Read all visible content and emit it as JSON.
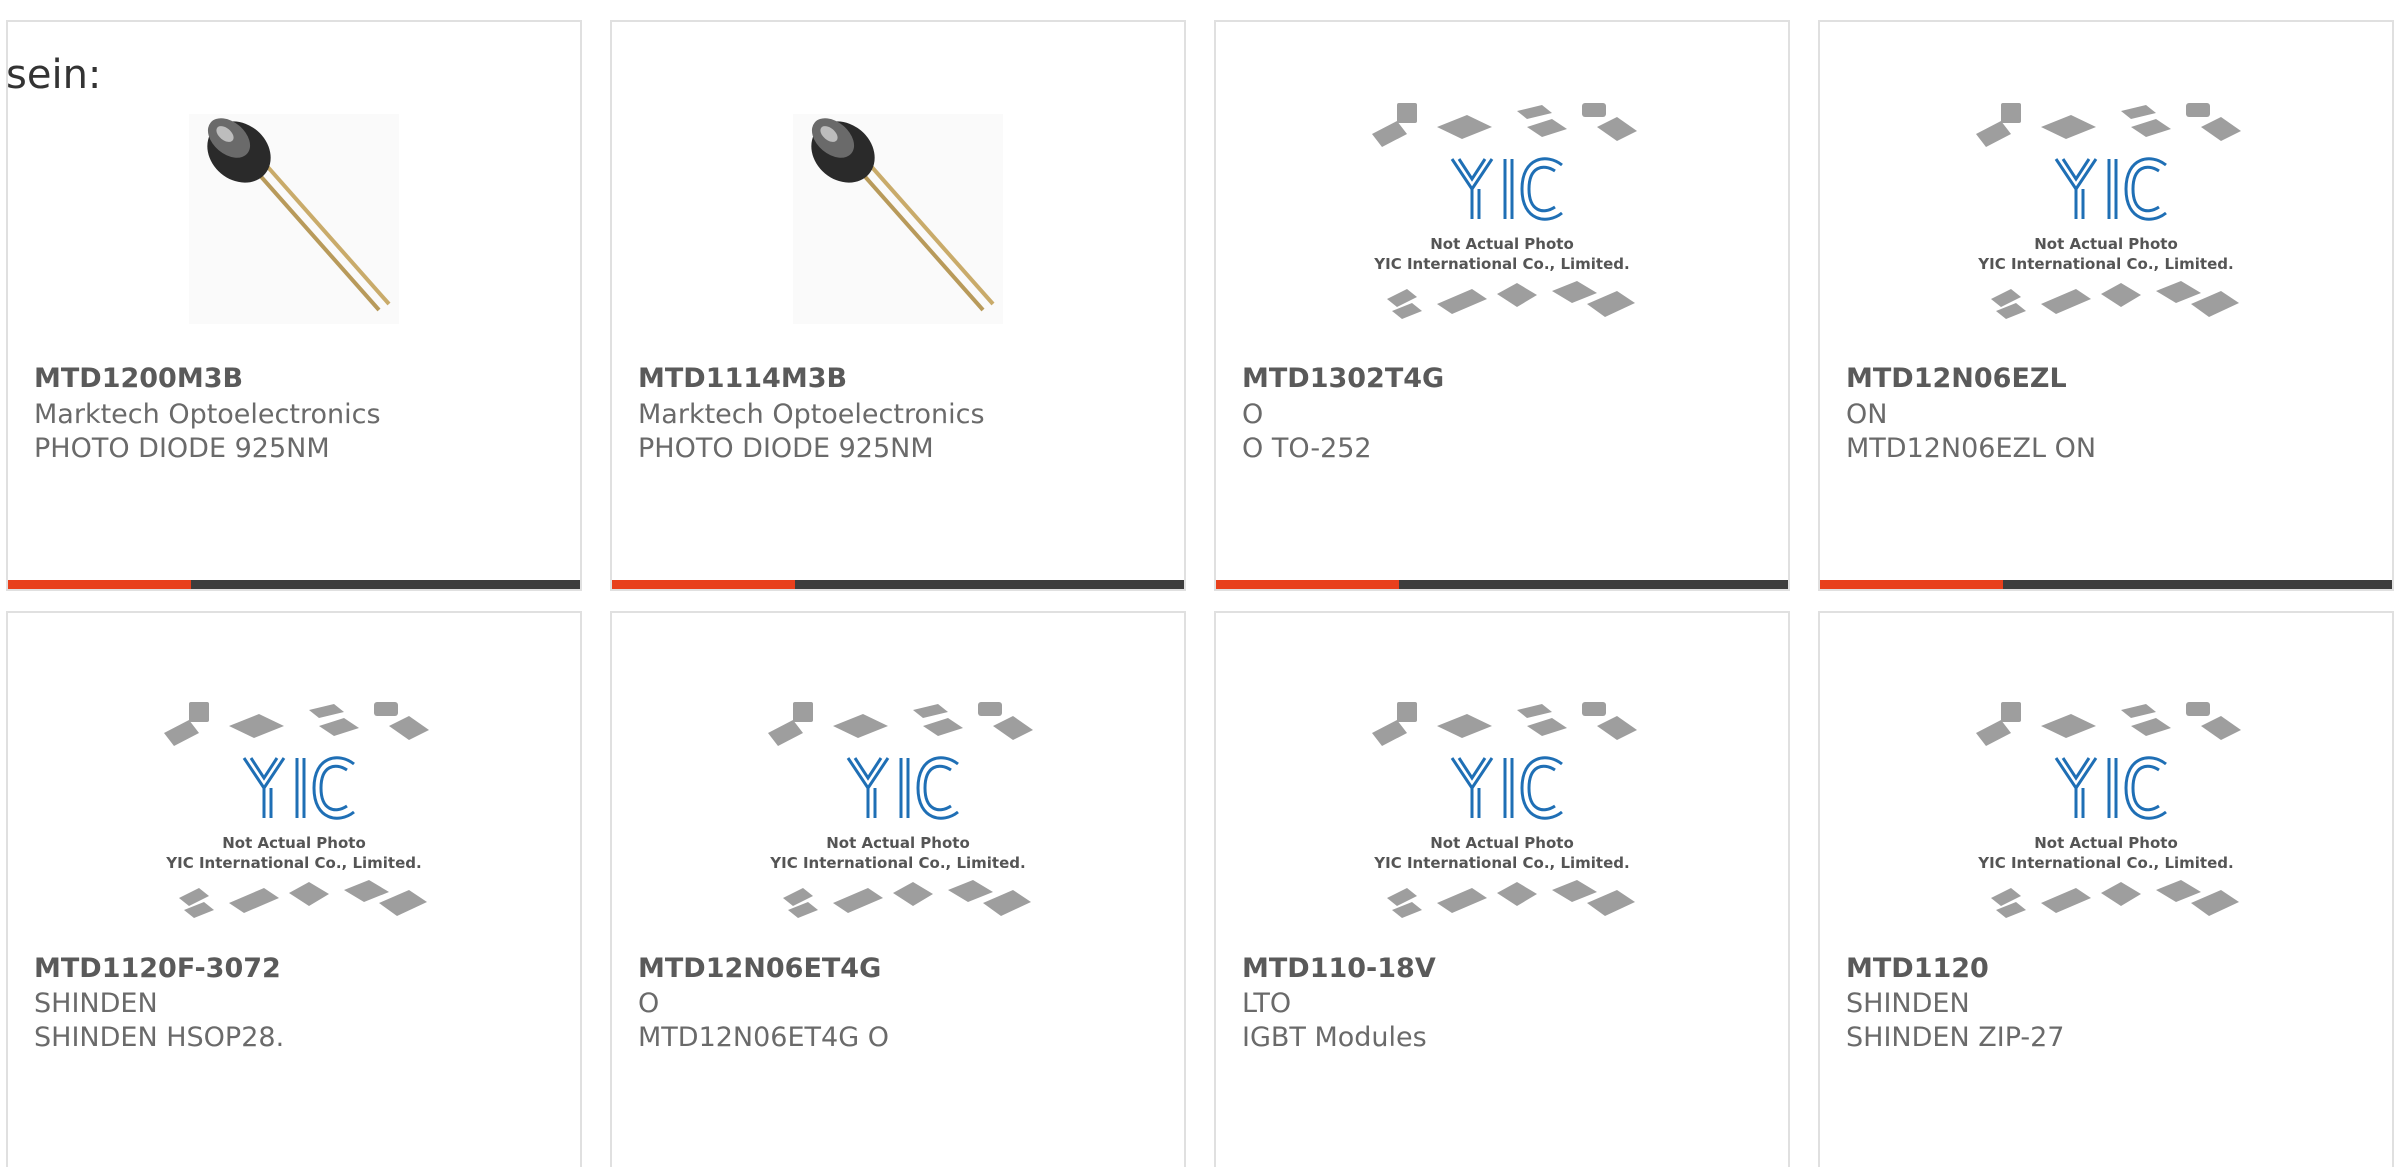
{
  "heading_fragment": "sein:",
  "colors": {
    "accent": "#e8401c",
    "bar_track": "#3d3d3d",
    "card_border": "#e0e0e0",
    "text": "#6a6a6a"
  },
  "products": [
    {
      "part": "MTD1200M3B",
      "maker": "Marktech Optoelectronics",
      "desc": "PHOTO DIODE 925NM",
      "image": "photodiode-photo",
      "progress": 0.32
    },
    {
      "part": "MTD1114M3B",
      "maker": "Marktech Optoelectronics",
      "desc": "PHOTO DIODE 925NM",
      "image": "photodiode-photo",
      "progress": 0.32
    },
    {
      "part": "MTD1302T4G",
      "maker": "O",
      "desc": "O TO-252",
      "image": "placeholder-logo",
      "progress": 0.32
    },
    {
      "part": "MTD12N06EZL",
      "maker": "ON",
      "desc": "MTD12N06EZL ON",
      "image": "placeholder-logo",
      "progress": 0.32
    },
    {
      "part": "MTD1120F-3072",
      "maker": "SHINDEN",
      "desc": "SHINDEN HSOP28.",
      "image": "placeholder-logo"
    },
    {
      "part": "MTD12N06ET4G",
      "maker": "O",
      "desc": "MTD12N06ET4G O",
      "image": "placeholder-logo"
    },
    {
      "part": "MTD110-18V",
      "maker": "LTO",
      "desc": "IGBT Modules",
      "image": "placeholder-logo"
    },
    {
      "part": "MTD1120",
      "maker": "SHINDEN",
      "desc": "SHINDEN ZIP-27",
      "image": "placeholder-logo"
    }
  ],
  "placeholder": {
    "logo_text": "YIC",
    "line1": "Not Actual Photo",
    "line2": "YIC International Co., Limited."
  }
}
